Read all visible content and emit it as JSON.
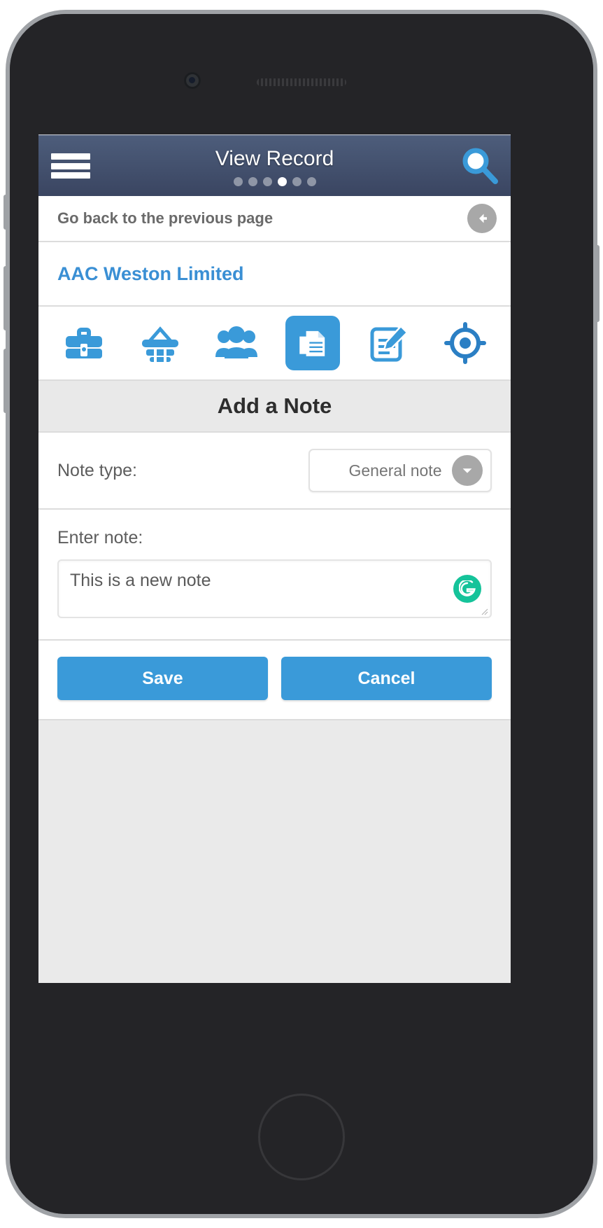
{
  "header": {
    "title": "View Record",
    "menu_icon": "hamburger-icon",
    "search_icon": "search-icon",
    "pager": {
      "total": 6,
      "active_index": 3
    }
  },
  "back_bar": {
    "label": "Go back to the previous page",
    "icon": "arrow-left-icon"
  },
  "record": {
    "name": "AAC Weston Limited"
  },
  "nav_icons": [
    {
      "name": "briefcase-icon",
      "label": "Opportunities",
      "active": false
    },
    {
      "name": "basket-icon",
      "label": "Orders",
      "active": false
    },
    {
      "name": "people-icon",
      "label": "Contacts",
      "active": false
    },
    {
      "name": "documents-icon",
      "label": "Notes",
      "active": true
    },
    {
      "name": "note-edit-icon",
      "label": "Tasks",
      "active": false
    },
    {
      "name": "target-icon",
      "label": "Location",
      "active": false
    }
  ],
  "section": {
    "heading": "Add a Note"
  },
  "form": {
    "note_type_label": "Note type:",
    "note_type_value": "General note",
    "note_type_options": [
      "General note"
    ],
    "note_type_chevron_icon": "chevron-down-icon",
    "enter_note_label": "Enter note:",
    "note_value": "This is a new note",
    "note_placeholder": "",
    "grammarly_icon": "grammarly-icon"
  },
  "actions": {
    "save_label": "Save",
    "cancel_label": "Cancel"
  },
  "colors": {
    "header_top": "#4d5d7b",
    "header_bottom": "#3a4561",
    "accent_blue": "#3a9ad9",
    "link_blue": "#3a8fd4",
    "grammarly_green": "#15c39a",
    "section_bg": "#e9e9e9"
  }
}
